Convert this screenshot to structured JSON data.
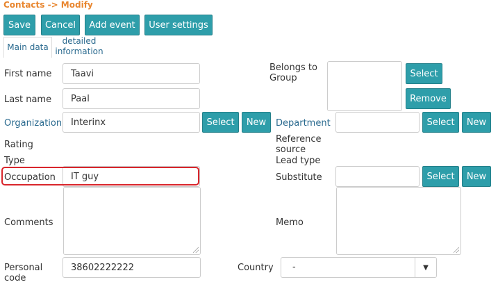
{
  "breadcrumb": "Contacts -> Modify",
  "toolbar": {
    "save": "Save",
    "cancel": "Cancel",
    "add_event": "Add event",
    "user_settings": "User settings"
  },
  "tabs": {
    "main_data": "Main data",
    "detailed_information": "detailed information"
  },
  "form": {
    "first_name": {
      "label": "First name",
      "value": "Taavi"
    },
    "last_name": {
      "label": "Last name",
      "value": "Paal"
    },
    "organization": {
      "label": "Organization",
      "value": "Interinx",
      "select": "Select",
      "new": "New"
    },
    "rating": {
      "label": "Rating"
    },
    "type": {
      "label": "Type"
    },
    "occupation": {
      "label": "Occupation",
      "value": "IT guy"
    },
    "comments": {
      "label": "Comments"
    },
    "personal_code": {
      "label": "Personal code",
      "value": "38602222222"
    },
    "belongs_to_group": {
      "label": "Belongs to Group",
      "select": "Select",
      "remove": "Remove"
    },
    "department": {
      "label": "Department",
      "value": "",
      "select": "Select",
      "new": "New"
    },
    "reference_source": {
      "label": "Reference source"
    },
    "lead_type": {
      "label": "Lead type"
    },
    "substitute": {
      "label": "Substitute",
      "value": "",
      "select": "Select",
      "new": "New"
    },
    "memo": {
      "label": "Memo"
    },
    "country": {
      "label": "Country",
      "value": "-"
    }
  },
  "colors": {
    "accent": "#2e9eaa",
    "breadcrumb": "#e8862f",
    "link": "#2a6a8f",
    "highlight": "#d9262c"
  }
}
